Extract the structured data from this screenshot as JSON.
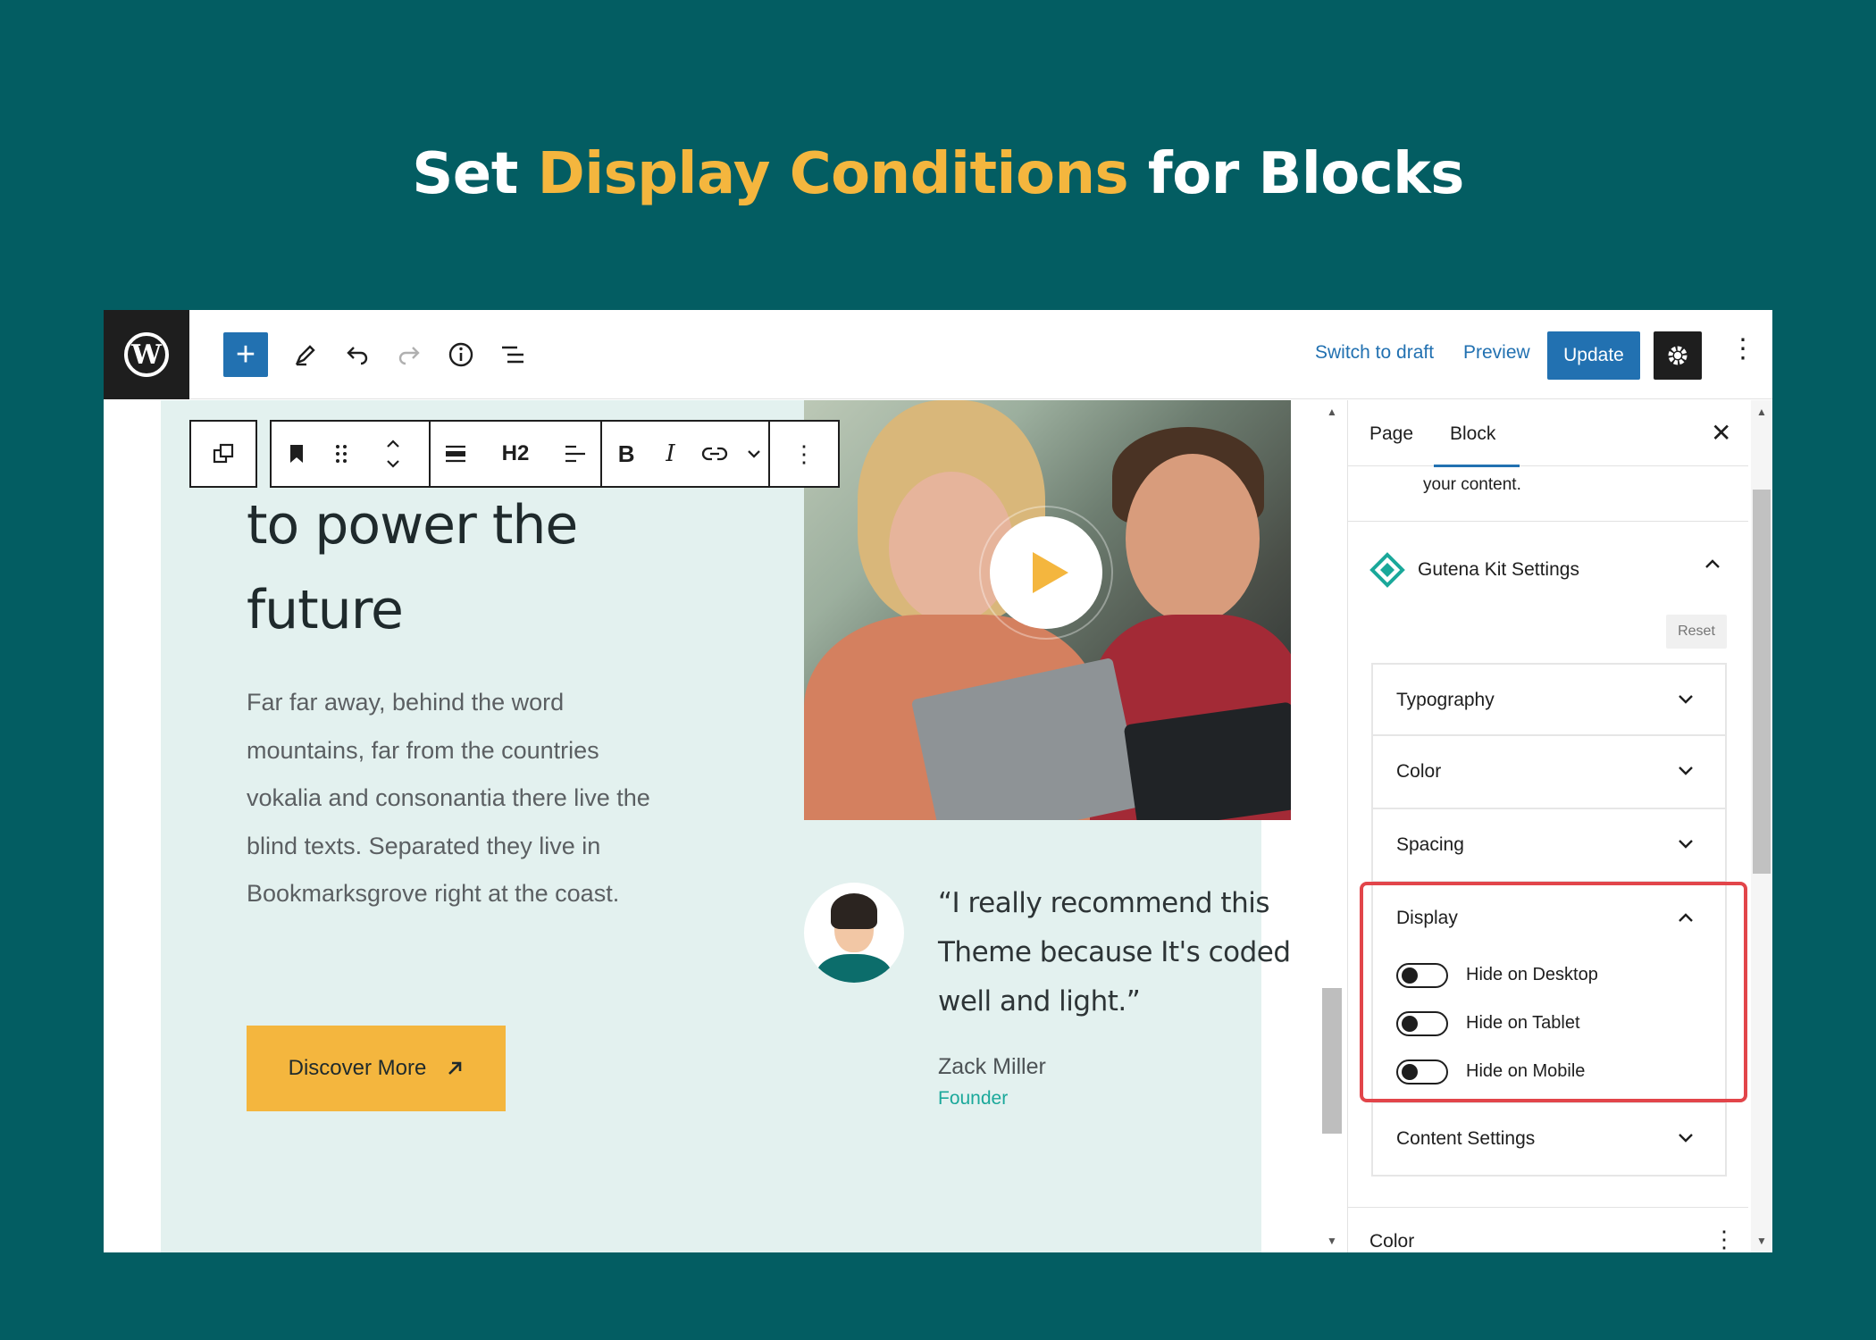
{
  "headline": {
    "prefix": "Set ",
    "highlight": "Display Conditions",
    "suffix": " for Blocks"
  },
  "colors": {
    "background": "#035d62",
    "accent": "#f4b63e",
    "wp_blue": "#2271b1",
    "highlight_border": "#e2454a",
    "section_bg": "#e3f1ef",
    "role_green": "#1aa89a"
  },
  "topbar": {
    "switch_to_draft": "Switch to draft",
    "preview": "Preview",
    "update": "Update"
  },
  "content": {
    "heading_lines": [
      "to power the",
      "future"
    ],
    "paragraph": "Far far away, behind the word mountains, far from the countries vokalia and consonantia there live the blind texts. Separated they live in Bookmarksgrove right at the coast.",
    "button_label": "Discover More",
    "quote": "“I really recommend this Theme because It's coded well and light.”",
    "quote_author": "Zack Miller",
    "quote_role": "Founder"
  },
  "block_toolbar": {
    "heading_level": "H2"
  },
  "sidebar": {
    "tabs": [
      "Page",
      "Block"
    ],
    "active_tab": "Block",
    "description_fragment": "your content.",
    "gutena_title": "Gutena Kit Settings",
    "reset": "Reset",
    "sections": [
      {
        "label": "Typography",
        "expanded": false
      },
      {
        "label": "Color",
        "expanded": false
      },
      {
        "label": "Spacing",
        "expanded": false
      },
      {
        "label": "Display",
        "expanded": true
      },
      {
        "label": "Content Settings",
        "expanded": false
      }
    ],
    "display_toggles": [
      {
        "label": "Hide on Desktop",
        "on": false
      },
      {
        "label": "Hide on Tablet",
        "on": false
      },
      {
        "label": "Hide on Mobile",
        "on": false
      }
    ],
    "bottom_panel": "Color"
  }
}
